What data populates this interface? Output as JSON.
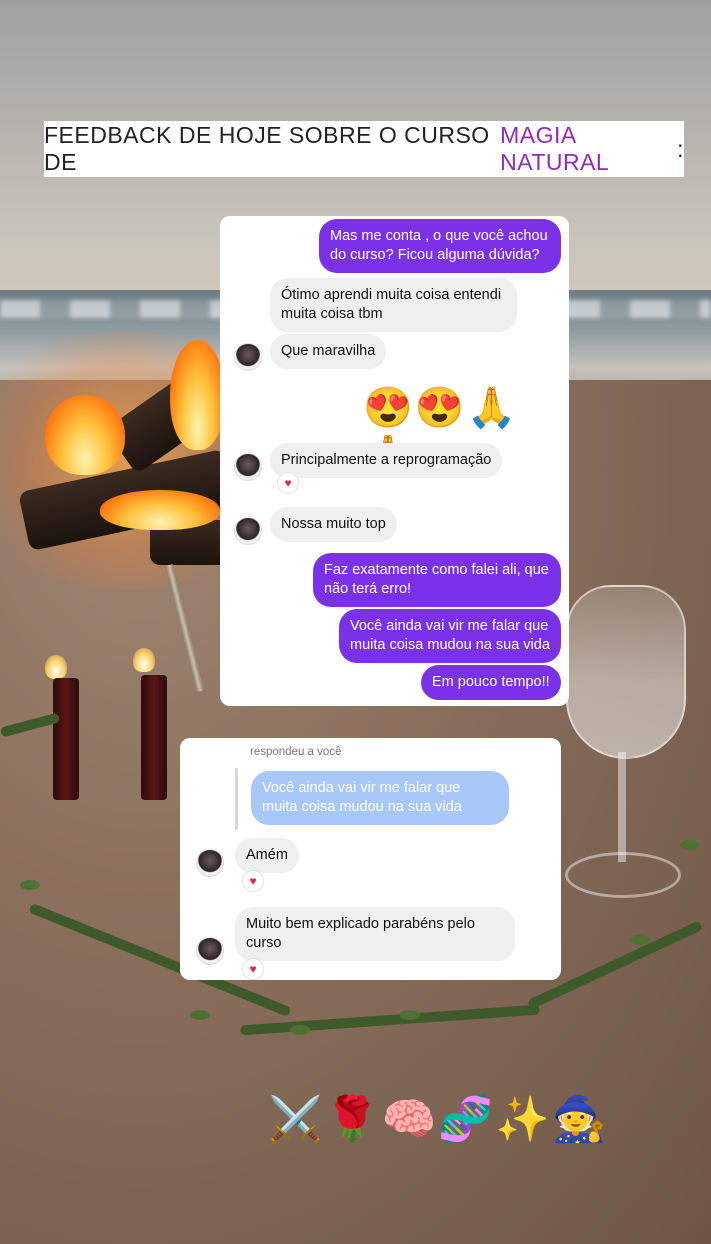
{
  "banner": {
    "text": "FEEDBACK DE HOJE SOBRE O CURSO DE",
    "accent": "MAGIA NATURAL",
    "suffix": ":",
    "accent_color": "#8e2db7"
  },
  "chat1": {
    "messages": [
      {
        "text": "Mas me conta , o que você achou do curso? Ficou alguma dúvida?",
        "sender": "me"
      },
      {
        "text": "Ótimo aprendi muita coisa entendi muita coisa tbm",
        "sender": "them"
      },
      {
        "text": "Que maravilha",
        "sender": "them"
      },
      {
        "text": "😍😍🙏🙏",
        "sender": "me"
      },
      {
        "text": "Principalmente a reprogramação",
        "sender": "them",
        "reaction": "♥"
      },
      {
        "text": "Nossa muito top",
        "sender": "them"
      },
      {
        "text": "Faz exatamente como falei ali, que não terá erro!",
        "sender": "me"
      },
      {
        "text": "Você ainda vai vir me falar que muita coisa mudou na sua vida",
        "sender": "me"
      },
      {
        "text": "Em pouco tempo!!",
        "sender": "me"
      }
    ]
  },
  "chat2": {
    "reply_label": "respondeu a você",
    "quoted": "Você ainda vai vir me falar que muita coisa mudou na sua vida",
    "messages": [
      {
        "text": "Amém",
        "sender": "them",
        "reaction": "♥"
      },
      {
        "text": "Muito bem explicado parabéns pelo curso",
        "sender": "them",
        "reaction": "♥"
      }
    ]
  },
  "footer_emojis": "⚔️🌹🧠🧬✨🧙",
  "colors": {
    "outgoing_bubble": "#7a31e8",
    "incoming_bubble": "#efefef",
    "quoted_bubble": "#a9c8fa",
    "reaction_heart": "#e0245e"
  }
}
